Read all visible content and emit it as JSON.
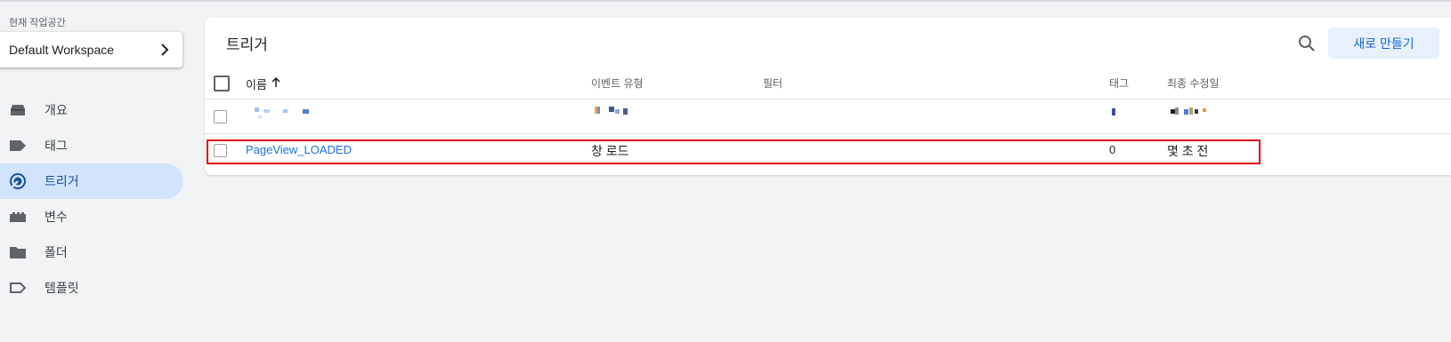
{
  "sidebar": {
    "workspace_label": "현재 작업공간",
    "workspace_name": "Default Workspace",
    "items": [
      {
        "label": "개요",
        "icon": "overview-icon"
      },
      {
        "label": "태그",
        "icon": "tag-icon"
      },
      {
        "label": "트리거",
        "icon": "trigger-icon",
        "active": true
      },
      {
        "label": "변수",
        "icon": "variable-icon"
      },
      {
        "label": "폴더",
        "icon": "folder-icon"
      },
      {
        "label": "템플릿",
        "icon": "template-icon"
      }
    ]
  },
  "main": {
    "title": "트리거",
    "new_button": "새로 만들기",
    "columns": {
      "name": "이름",
      "event_type": "이벤트 유형",
      "filter": "필터",
      "tags": "태그",
      "last_edited": "최종 수정일"
    },
    "sort_icon": "arrow-up-icon",
    "rows": [
      {
        "name": "PageView_LOADED",
        "event_type": "창 로드",
        "filter": "",
        "tags": "0",
        "last_edited": "몇 초 전"
      }
    ]
  },
  "colors": {
    "accent": "#1a73e8",
    "active_nav": "#d2e3fc",
    "highlight": "#e30000"
  }
}
